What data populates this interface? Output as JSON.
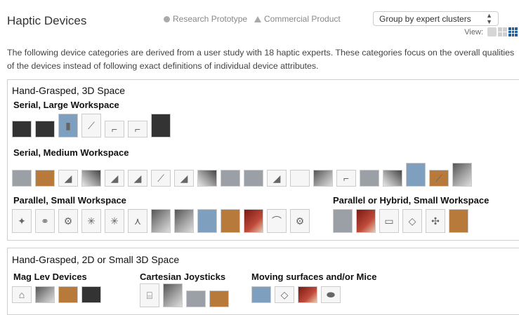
{
  "header": {
    "title": "Haptic Devices",
    "legend": {
      "research_prototype": "Research Prototype",
      "commercial_product": "Commercial Product"
    },
    "group_by": {
      "selected": "Group by expert clusters"
    },
    "view_label": "View:"
  },
  "intro": "The following device categories are derived from a user study with 18 haptic experts. These categories focus on the overall qualities of the devices instead of following exact definitions of individual device attributes.",
  "clusters": [
    {
      "title": "Hand-Grasped, 3D Space",
      "subcategories": [
        {
          "title": "Serial, Large Workspace",
          "device_count": 7
        },
        {
          "title": "Serial, Medium Workspace",
          "device_count": 20
        },
        {
          "title": "Parallel, Small Workspace",
          "device_count": 13
        },
        {
          "title": "Parallel or Hybrid, Small Workspace",
          "device_count": 6
        }
      ]
    },
    {
      "title": "Hand-Grasped, 2D or Small 3D Space",
      "subcategories": [
        {
          "title": "Mag Lev Devices",
          "device_count": 4
        },
        {
          "title": "Cartesian Joysticks",
          "device_count": 4
        },
        {
          "title": "Moving surfaces and/or Mice",
          "device_count": 4
        }
      ]
    }
  ]
}
